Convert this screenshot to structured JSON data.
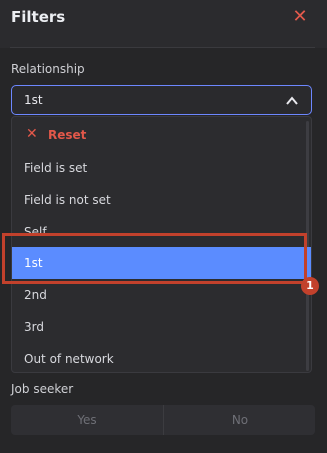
{
  "header": {
    "title": "Filters",
    "close_icon": "close-icon",
    "accent_color": "#e35a4c"
  },
  "relationship": {
    "label": "Relationship",
    "selected_value": "1st",
    "chevron_icon": "chevron-up-icon",
    "options": [
      {
        "label": "Reset",
        "type": "reset"
      },
      {
        "label": "Field is set"
      },
      {
        "label": "Field is not set"
      },
      {
        "label": "Self"
      },
      {
        "label": "1st",
        "selected": true
      },
      {
        "label": "2nd"
      },
      {
        "label": "3rd"
      },
      {
        "label": "Out of network"
      }
    ],
    "selected_color": "#5b8cff"
  },
  "annotation": {
    "badge": "1",
    "color": "#c2412c"
  },
  "job_seeker": {
    "label": "Job seeker",
    "yes_label": "Yes",
    "no_label": "No"
  }
}
